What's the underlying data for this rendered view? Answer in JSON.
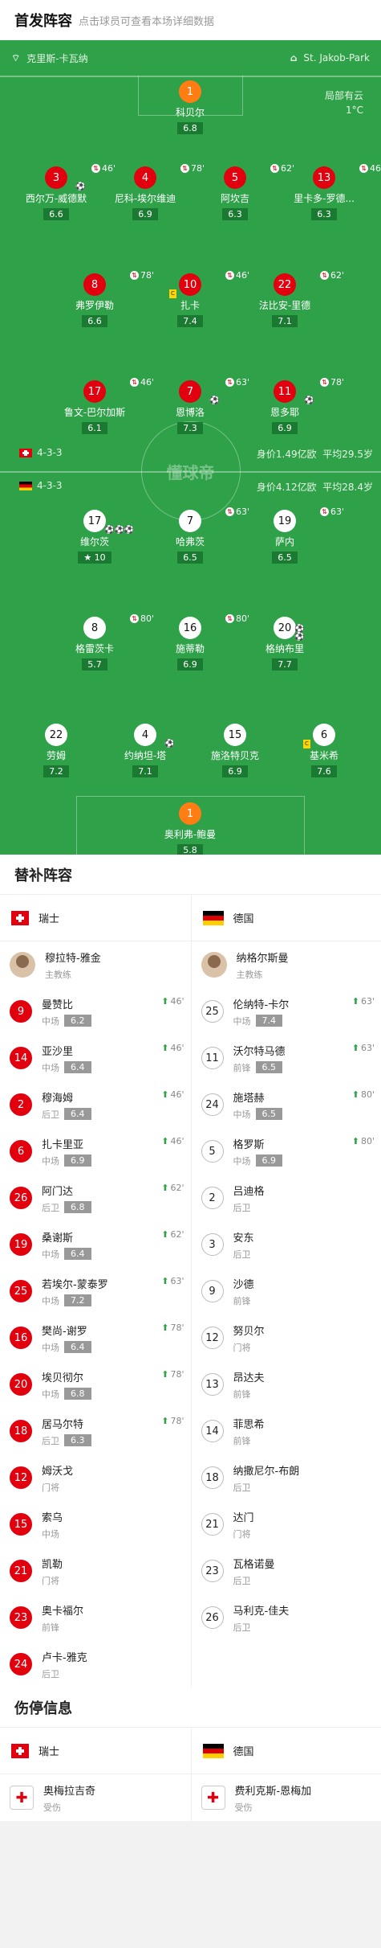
{
  "header": {
    "title": "首发阵容",
    "subtitle": "点击球员可查看本场详细数据"
  },
  "pitch_info": {
    "stadium": "克里斯-卡瓦纳",
    "venue": "St. Jakob-Park",
    "weather": "局部有云",
    "temperature": "1°C",
    "watermark": "懂球帝"
  },
  "swiss": {
    "formation": "4-3-3",
    "value": "身价1.49亿欧",
    "avg_age": "平均29.5岁"
  },
  "germany": {
    "formation": "4-3-3",
    "value": "身价4.12亿欧",
    "avg_age": "平均28.4岁"
  },
  "swiss_starters": [
    {
      "num": "1",
      "name": "科贝尔",
      "rating": "6.8",
      "sub": ""
    },
    {
      "num": "3",
      "name": "西尔万-威德默",
      "rating": "6.6",
      "sub": "46'"
    },
    {
      "num": "4",
      "name": "尼科-埃尔维迪",
      "rating": "6.9",
      "sub": "78'"
    },
    {
      "num": "5",
      "name": "阿坎吉",
      "rating": "6.3",
      "sub": "62'"
    },
    {
      "num": "13",
      "name": "里卡多-罗德...",
      "rating": "6.3",
      "sub": "46'"
    },
    {
      "num": "8",
      "name": "弗罗伊勒",
      "rating": "6.6",
      "sub": "78'"
    },
    {
      "num": "10",
      "name": "扎卡",
      "rating": "7.4",
      "sub": "46'"
    },
    {
      "num": "22",
      "name": "法比安-里德",
      "rating": "7.1",
      "sub": "62'"
    },
    {
      "num": "17",
      "name": "鲁文-巴尔加斯",
      "rating": "6.1",
      "sub": "46'"
    },
    {
      "num": "7",
      "name": "恩博洛",
      "rating": "7.3",
      "sub": "63'"
    },
    {
      "num": "11",
      "name": "恩多耶",
      "rating": "6.9",
      "sub": "78'"
    }
  ],
  "germany_starters": [
    {
      "num": "17",
      "name": "维尔茨",
      "rating": "10",
      "sub": ""
    },
    {
      "num": "7",
      "name": "哈弗茨",
      "rating": "6.5",
      "sub": "63'"
    },
    {
      "num": "19",
      "name": "萨内",
      "rating": "6.5",
      "sub": "63'"
    },
    {
      "num": "8",
      "name": "格雷茨卡",
      "rating": "5.7",
      "sub": "80'"
    },
    {
      "num": "16",
      "name": "施蒂勒",
      "rating": "6.9",
      "sub": "80'"
    },
    {
      "num": "20",
      "name": "格纳布里",
      "rating": "7.7",
      "sub": ""
    },
    {
      "num": "22",
      "name": "劳姆",
      "rating": "7.2",
      "sub": ""
    },
    {
      "num": "4",
      "name": "约纳坦-塔",
      "rating": "7.1",
      "sub": ""
    },
    {
      "num": "15",
      "name": "施洛特贝克",
      "rating": "6.9",
      "sub": ""
    },
    {
      "num": "6",
      "name": "基米希",
      "rating": "7.6",
      "sub": ""
    },
    {
      "num": "1",
      "name": "奥利弗-鲍曼",
      "rating": "5.8",
      "sub": ""
    }
  ],
  "subs": {
    "title": "替补阵容",
    "swiss_team": "瑞士",
    "germany_team": "德国",
    "swiss_coach": {
      "name": "穆拉特-雅金",
      "role": "主教练"
    },
    "germany_coach": {
      "name": "纳格尔斯曼",
      "role": "主教练"
    },
    "swiss": [
      {
        "num": "9",
        "name": "曼赞比",
        "pos": "中场",
        "rating": "6.2",
        "time": "46'",
        "red": true
      },
      {
        "num": "14",
        "name": "亚沙里",
        "pos": "中场",
        "rating": "6.4",
        "time": "46'",
        "red": true
      },
      {
        "num": "2",
        "name": "穆海姆",
        "pos": "后卫",
        "rating": "6.4",
        "time": "46'",
        "red": true
      },
      {
        "num": "6",
        "name": "扎卡里亚",
        "pos": "中场",
        "rating": "6.9",
        "time": "46'",
        "red": true
      },
      {
        "num": "26",
        "name": "阿门达",
        "pos": "后卫",
        "rating": "6.8",
        "time": "62'",
        "red": true
      },
      {
        "num": "19",
        "name": "桑谢斯",
        "pos": "中场",
        "rating": "6.4",
        "time": "62'",
        "red": true
      },
      {
        "num": "25",
        "name": "若埃尔-蒙泰罗",
        "pos": "中场",
        "rating": "7.2",
        "time": "63'",
        "red": true
      },
      {
        "num": "16",
        "name": "樊尚-谢罗",
        "pos": "中场",
        "rating": "6.4",
        "time": "78'",
        "red": true
      },
      {
        "num": "20",
        "name": "埃贝彻尔",
        "pos": "中场",
        "rating": "6.8",
        "time": "78'",
        "red": true
      },
      {
        "num": "18",
        "name": "居马尔特",
        "pos": "后卫",
        "rating": "6.3",
        "time": "78'",
        "red": true
      },
      {
        "num": "12",
        "name": "姆沃戈",
        "pos": "门将",
        "rating": "",
        "time": "",
        "red": true
      },
      {
        "num": "15",
        "name": "索乌",
        "pos": "中场",
        "rating": "",
        "time": "",
        "red": true
      },
      {
        "num": "21",
        "name": "凯勒",
        "pos": "门将",
        "rating": "",
        "time": "",
        "red": true
      },
      {
        "num": "23",
        "name": "奥卡福尔",
        "pos": "前锋",
        "rating": "",
        "time": "",
        "red": true
      },
      {
        "num": "24",
        "name": "卢卡-雅克",
        "pos": "后卫",
        "rating": "",
        "time": "",
        "red": true
      }
    ],
    "germany": [
      {
        "num": "25",
        "name": "伦纳特-卡尔",
        "pos": "中场",
        "rating": "7.4",
        "time": "63'"
      },
      {
        "num": "11",
        "name": "沃尔特马德",
        "pos": "前锋",
        "rating": "6.5",
        "time": "63'"
      },
      {
        "num": "24",
        "name": "施塔赫",
        "pos": "中场",
        "rating": "6.5",
        "time": "80'"
      },
      {
        "num": "5",
        "name": "格罗斯",
        "pos": "中场",
        "rating": "6.9",
        "time": "80'"
      },
      {
        "num": "2",
        "name": "吕迪格",
        "pos": "后卫",
        "rating": "",
        "time": ""
      },
      {
        "num": "3",
        "name": "安东",
        "pos": "后卫",
        "rating": "",
        "time": ""
      },
      {
        "num": "9",
        "name": "沙德",
        "pos": "前锋",
        "rating": "",
        "time": ""
      },
      {
        "num": "12",
        "name": "努贝尔",
        "pos": "门将",
        "rating": "",
        "time": ""
      },
      {
        "num": "13",
        "name": "昂达夫",
        "pos": "前锋",
        "rating": "",
        "time": ""
      },
      {
        "num": "14",
        "name": "菲思希",
        "pos": "前锋",
        "rating": "",
        "time": ""
      },
      {
        "num": "18",
        "name": "纳撒尼尔-布朗",
        "pos": "后卫",
        "rating": "",
        "time": ""
      },
      {
        "num": "21",
        "name": "达门",
        "pos": "门将",
        "rating": "",
        "time": ""
      },
      {
        "num": "23",
        "name": "瓦格诺曼",
        "pos": "后卫",
        "rating": "",
        "time": ""
      },
      {
        "num": "26",
        "name": "马利克-佳夫",
        "pos": "后卫",
        "rating": "",
        "time": ""
      }
    ]
  },
  "injury": {
    "title": "伤停信息",
    "swiss_team": "瑞士",
    "germany_team": "德国",
    "swiss": {
      "name": "奥梅拉吉奇",
      "status": "受伤"
    },
    "germany": {
      "name": "费利克斯-恩梅加",
      "status": "受伤"
    }
  }
}
